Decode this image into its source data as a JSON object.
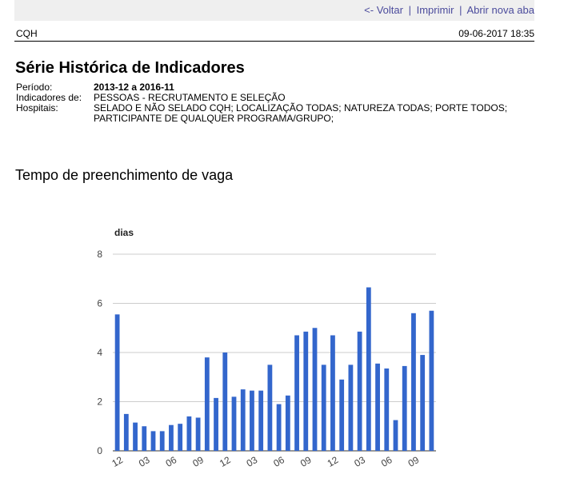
{
  "nav": {
    "back": "<- Voltar",
    "print": "Imprimir",
    "new_tab": "Abrir nova aba",
    "separator": "|"
  },
  "meta": {
    "org": "CQH",
    "timestamp": "09-06-2017 18:35"
  },
  "report": {
    "title": "Série Histórica de Indicadores",
    "params": [
      {
        "label": "Período:",
        "value": "2013-12 a 2016-11"
      },
      {
        "label": "Indicadores de:",
        "value": "PESSOAS - RECRUTAMENTO E SELEÇÃO"
      },
      {
        "label": "Hospitais:",
        "value": "SELADO E NÃO SELADO CQH; LOCALIZAÇÃO TODAS; NATUREZA TODAS; PORTE TODOS; PARTICIPANTE DE QUALQUER PROGRAMA/GRUPO;"
      }
    ]
  },
  "section": {
    "title": "Tempo de preenchimento de vaga"
  },
  "chart_data": {
    "type": "bar",
    "title": "",
    "ylabel": "dias",
    "xlabel": "",
    "ylim": [
      0,
      8
    ],
    "yticks": [
      0,
      2,
      4,
      6,
      8
    ],
    "grid": true,
    "bar_color": "#3366cc",
    "categories": [
      "2013-12",
      "2014-01",
      "2014-02",
      "2014-03",
      "2014-04",
      "2014-05",
      "2014-06",
      "2014-07",
      "2014-08",
      "2014-09",
      "2014-10",
      "2014-11",
      "2014-12",
      "2015-01",
      "2015-02",
      "2015-03",
      "2015-04",
      "2015-05",
      "2015-06",
      "2015-07",
      "2015-08",
      "2015-09",
      "2015-10",
      "2015-11",
      "2015-12",
      "2016-01",
      "2016-02",
      "2016-03",
      "2016-04",
      "2016-05",
      "2016-06",
      "2016-07",
      "2016-08",
      "2016-09",
      "2016-10",
      "2016-11"
    ],
    "tick_labels": [
      {
        "index": 0,
        "label": "12"
      },
      {
        "index": 3,
        "label": "03"
      },
      {
        "index": 6,
        "label": "06"
      },
      {
        "index": 9,
        "label": "09"
      },
      {
        "index": 12,
        "label": "12"
      },
      {
        "index": 15,
        "label": "03"
      },
      {
        "index": 18,
        "label": "06"
      },
      {
        "index": 21,
        "label": "09"
      },
      {
        "index": 24,
        "label": "12"
      },
      {
        "index": 27,
        "label": "03"
      },
      {
        "index": 30,
        "label": "06"
      },
      {
        "index": 33,
        "label": "09"
      }
    ],
    "values": [
      5.55,
      1.5,
      1.15,
      1.0,
      0.8,
      0.8,
      1.05,
      1.1,
      1.4,
      1.35,
      3.8,
      2.15,
      4.0,
      2.2,
      2.5,
      2.45,
      2.45,
      3.5,
      1.9,
      2.25,
      4.7,
      4.85,
      5.0,
      3.5,
      4.7,
      2.9,
      3.5,
      4.85,
      6.65,
      3.55,
      3.35,
      1.25,
      3.45,
      5.6,
      3.9,
      5.7
    ]
  }
}
